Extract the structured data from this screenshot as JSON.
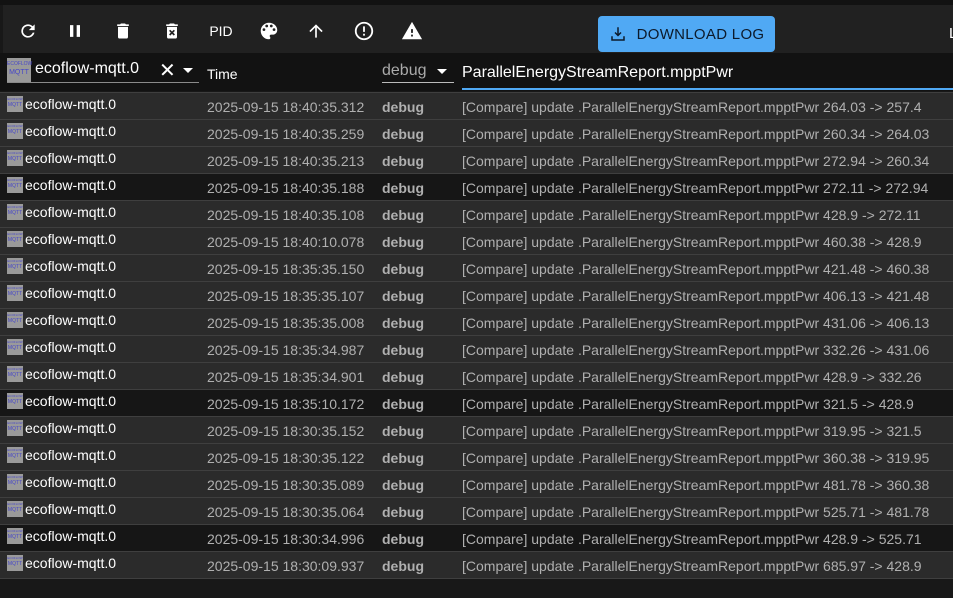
{
  "toolbar": {
    "icons": [
      "refresh-icon",
      "pause-icon",
      "delete-icon",
      "delete-forever-icon",
      "palette-icon",
      "arrow-up-icon",
      "error-icon",
      "warning-icon"
    ],
    "pid_label": "PID",
    "download_label": "DOWNLOAD LOG",
    "cut_label": "L"
  },
  "header": {
    "source_logo": "ECOFLOW MQTT",
    "source_value": "ecoflow-mqtt.0",
    "time_label": "Time",
    "level_value": "debug",
    "filter_value": "ParallelEnergyStreamReport.mpptPwr"
  },
  "colors": {
    "accent": "#50a9f4",
    "row": "#2b2b2b",
    "row_dark": "#161616"
  },
  "rows": [
    {
      "source": "ecoflow-mqtt.0",
      "time": "2025-09-15 18:40:35.312",
      "level": "debug",
      "message": "[Compare] update .ParallelEnergyStreamReport.mpptPwr 264.03 -> 257.4",
      "dark": false
    },
    {
      "source": "ecoflow-mqtt.0",
      "time": "2025-09-15 18:40:35.259",
      "level": "debug",
      "message": "[Compare] update .ParallelEnergyStreamReport.mpptPwr 260.34 -> 264.03",
      "dark": false
    },
    {
      "source": "ecoflow-mqtt.0",
      "time": "2025-09-15 18:40:35.213",
      "level": "debug",
      "message": "[Compare] update .ParallelEnergyStreamReport.mpptPwr 272.94 -> 260.34",
      "dark": false
    },
    {
      "source": "ecoflow-mqtt.0",
      "time": "2025-09-15 18:40:35.188",
      "level": "debug",
      "message": "[Compare] update .ParallelEnergyStreamReport.mpptPwr 272.11 -> 272.94",
      "dark": true
    },
    {
      "source": "ecoflow-mqtt.0",
      "time": "2025-09-15 18:40:35.108",
      "level": "debug",
      "message": "[Compare] update .ParallelEnergyStreamReport.mpptPwr 428.9 -> 272.11",
      "dark": false
    },
    {
      "source": "ecoflow-mqtt.0",
      "time": "2025-09-15 18:40:10.078",
      "level": "debug",
      "message": "[Compare] update .ParallelEnergyStreamReport.mpptPwr 460.38 -> 428.9",
      "dark": false
    },
    {
      "source": "ecoflow-mqtt.0",
      "time": "2025-09-15 18:35:35.150",
      "level": "debug",
      "message": "[Compare] update .ParallelEnergyStreamReport.mpptPwr 421.48 -> 460.38",
      "dark": false
    },
    {
      "source": "ecoflow-mqtt.0",
      "time": "2025-09-15 18:35:35.107",
      "level": "debug",
      "message": "[Compare] update .ParallelEnergyStreamReport.mpptPwr 406.13 -> 421.48",
      "dark": false
    },
    {
      "source": "ecoflow-mqtt.0",
      "time": "2025-09-15 18:35:35.008",
      "level": "debug",
      "message": "[Compare] update .ParallelEnergyStreamReport.mpptPwr 431.06 -> 406.13",
      "dark": false
    },
    {
      "source": "ecoflow-mqtt.0",
      "time": "2025-09-15 18:35:34.987",
      "level": "debug",
      "message": "[Compare] update .ParallelEnergyStreamReport.mpptPwr 332.26 -> 431.06",
      "dark": false
    },
    {
      "source": "ecoflow-mqtt.0",
      "time": "2025-09-15 18:35:34.901",
      "level": "debug",
      "message": "[Compare] update .ParallelEnergyStreamReport.mpptPwr 428.9 -> 332.26",
      "dark": false
    },
    {
      "source": "ecoflow-mqtt.0",
      "time": "2025-09-15 18:35:10.172",
      "level": "debug",
      "message": "[Compare] update .ParallelEnergyStreamReport.mpptPwr 321.5 -> 428.9",
      "dark": true
    },
    {
      "source": "ecoflow-mqtt.0",
      "time": "2025-09-15 18:30:35.152",
      "level": "debug",
      "message": "[Compare] update .ParallelEnergyStreamReport.mpptPwr 319.95 -> 321.5",
      "dark": false
    },
    {
      "source": "ecoflow-mqtt.0",
      "time": "2025-09-15 18:30:35.122",
      "level": "debug",
      "message": "[Compare] update .ParallelEnergyStreamReport.mpptPwr 360.38 -> 319.95",
      "dark": false
    },
    {
      "source": "ecoflow-mqtt.0",
      "time": "2025-09-15 18:30:35.089",
      "level": "debug",
      "message": "[Compare] update .ParallelEnergyStreamReport.mpptPwr 481.78 -> 360.38",
      "dark": false
    },
    {
      "source": "ecoflow-mqtt.0",
      "time": "2025-09-15 18:30:35.064",
      "level": "debug",
      "message": "[Compare] update .ParallelEnergyStreamReport.mpptPwr 525.71 -> 481.78",
      "dark": false
    },
    {
      "source": "ecoflow-mqtt.0",
      "time": "2025-09-15 18:30:34.996",
      "level": "debug",
      "message": "[Compare] update .ParallelEnergyStreamReport.mpptPwr 428.9 -> 525.71",
      "dark": true
    },
    {
      "source": "ecoflow-mqtt.0",
      "time": "2025-09-15 18:30:09.937",
      "level": "debug",
      "message": "[Compare] update .ParallelEnergyStreamReport.mpptPwr 685.97 -> 428.9",
      "dark": false
    }
  ]
}
